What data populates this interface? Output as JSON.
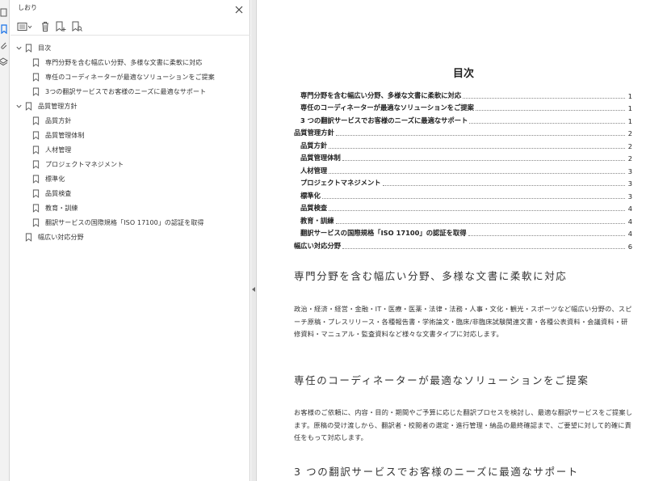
{
  "panel": {
    "title": "しおり"
  },
  "bookmarks": [
    {
      "label": "目次",
      "level": 0,
      "expanded": true
    },
    {
      "label": "専門分野を含む幅広い分野、多様な文書に柔軟に対応",
      "level": 1
    },
    {
      "label": "専任のコーディネーターが最適なソリューションをご提案",
      "level": 1
    },
    {
      "label": "3つの翻訳サービスでお客様のニーズに最適なサポート",
      "level": 1
    },
    {
      "label": "品質管理方針",
      "level": 0,
      "expanded": true
    },
    {
      "label": "品質方針",
      "level": 1
    },
    {
      "label": "品質管理体制",
      "level": 1
    },
    {
      "label": "人材管理",
      "level": 1
    },
    {
      "label": "プロジェクトマネジメント",
      "level": 1
    },
    {
      "label": "標準化",
      "level": 1
    },
    {
      "label": "品質検査",
      "level": 1
    },
    {
      "label": "教育・訓練",
      "level": 1
    },
    {
      "label": "翻訳サービスの国際規格「ISO 17100」の認証を取得",
      "level": 1
    },
    {
      "label": "幅広い対応分野",
      "level": 0,
      "leaf": true
    }
  ],
  "document": {
    "toc_title": "目次",
    "toc": [
      {
        "text": "専門分野を含む幅広い分野、多様な文書に柔軟に対応",
        "page": "1",
        "sub": true
      },
      {
        "text": "専任のコーディネーターが最適なソリューションをご提案",
        "page": "1",
        "sub": true
      },
      {
        "text": "3 つの翻訳サービスでお客様のニーズに最適なサポート",
        "page": "1",
        "sub": true
      },
      {
        "text": "品質管理方針",
        "page": "2",
        "sub": false
      },
      {
        "text": "品質方針",
        "page": "2",
        "sub": true
      },
      {
        "text": "品質管理体制",
        "page": "2",
        "sub": true
      },
      {
        "text": "人材管理",
        "page": "3",
        "sub": true
      },
      {
        "text": "プロジェクトマネジメント",
        "page": "3",
        "sub": true
      },
      {
        "text": "標準化",
        "page": "3",
        "sub": true
      },
      {
        "text": "品質検査",
        "page": "4",
        "sub": true
      },
      {
        "text": "教育・訓練",
        "page": "4",
        "sub": true
      },
      {
        "text": "翻訳サービスの国際規格「ISO 17100」の認証を取得",
        "page": "4",
        "sub": true
      },
      {
        "text": "幅広い対応分野",
        "page": "6",
        "sub": false
      }
    ],
    "section1": {
      "heading": "専門分野を含む幅広い分野、多様な文書に柔軟に対応",
      "body": "政治・経済・経営・金融・IT・医療・医薬・法律・法務・人事・文化・観光・スポーツなど幅広い分野の、スピーチ原稿・プレスリリース・各種報告書・学術論文・臨床/非臨床試験関連文書・各種公表資料・会議資料・研修資料・マニュアル・監査資料など様々な文書タイプに対応します。"
    },
    "section2": {
      "heading": "専任のコーディネーターが最適なソリューションをご提案",
      "body": "お客様のご依頼に、内容・目的・期間やご予算に応じた翻訳プロセスを検討し、最適な翻訳サービスをご提案します。原稿の受け渡しから、翻訳者・校閲者の選定・進行管理・納品の最終確認まで、ご要望に対して的確に責任をもって対応します。"
    },
    "section3": {
      "heading": "3 つの翻訳サービスでお客様のニーズに最適なサポート"
    }
  }
}
